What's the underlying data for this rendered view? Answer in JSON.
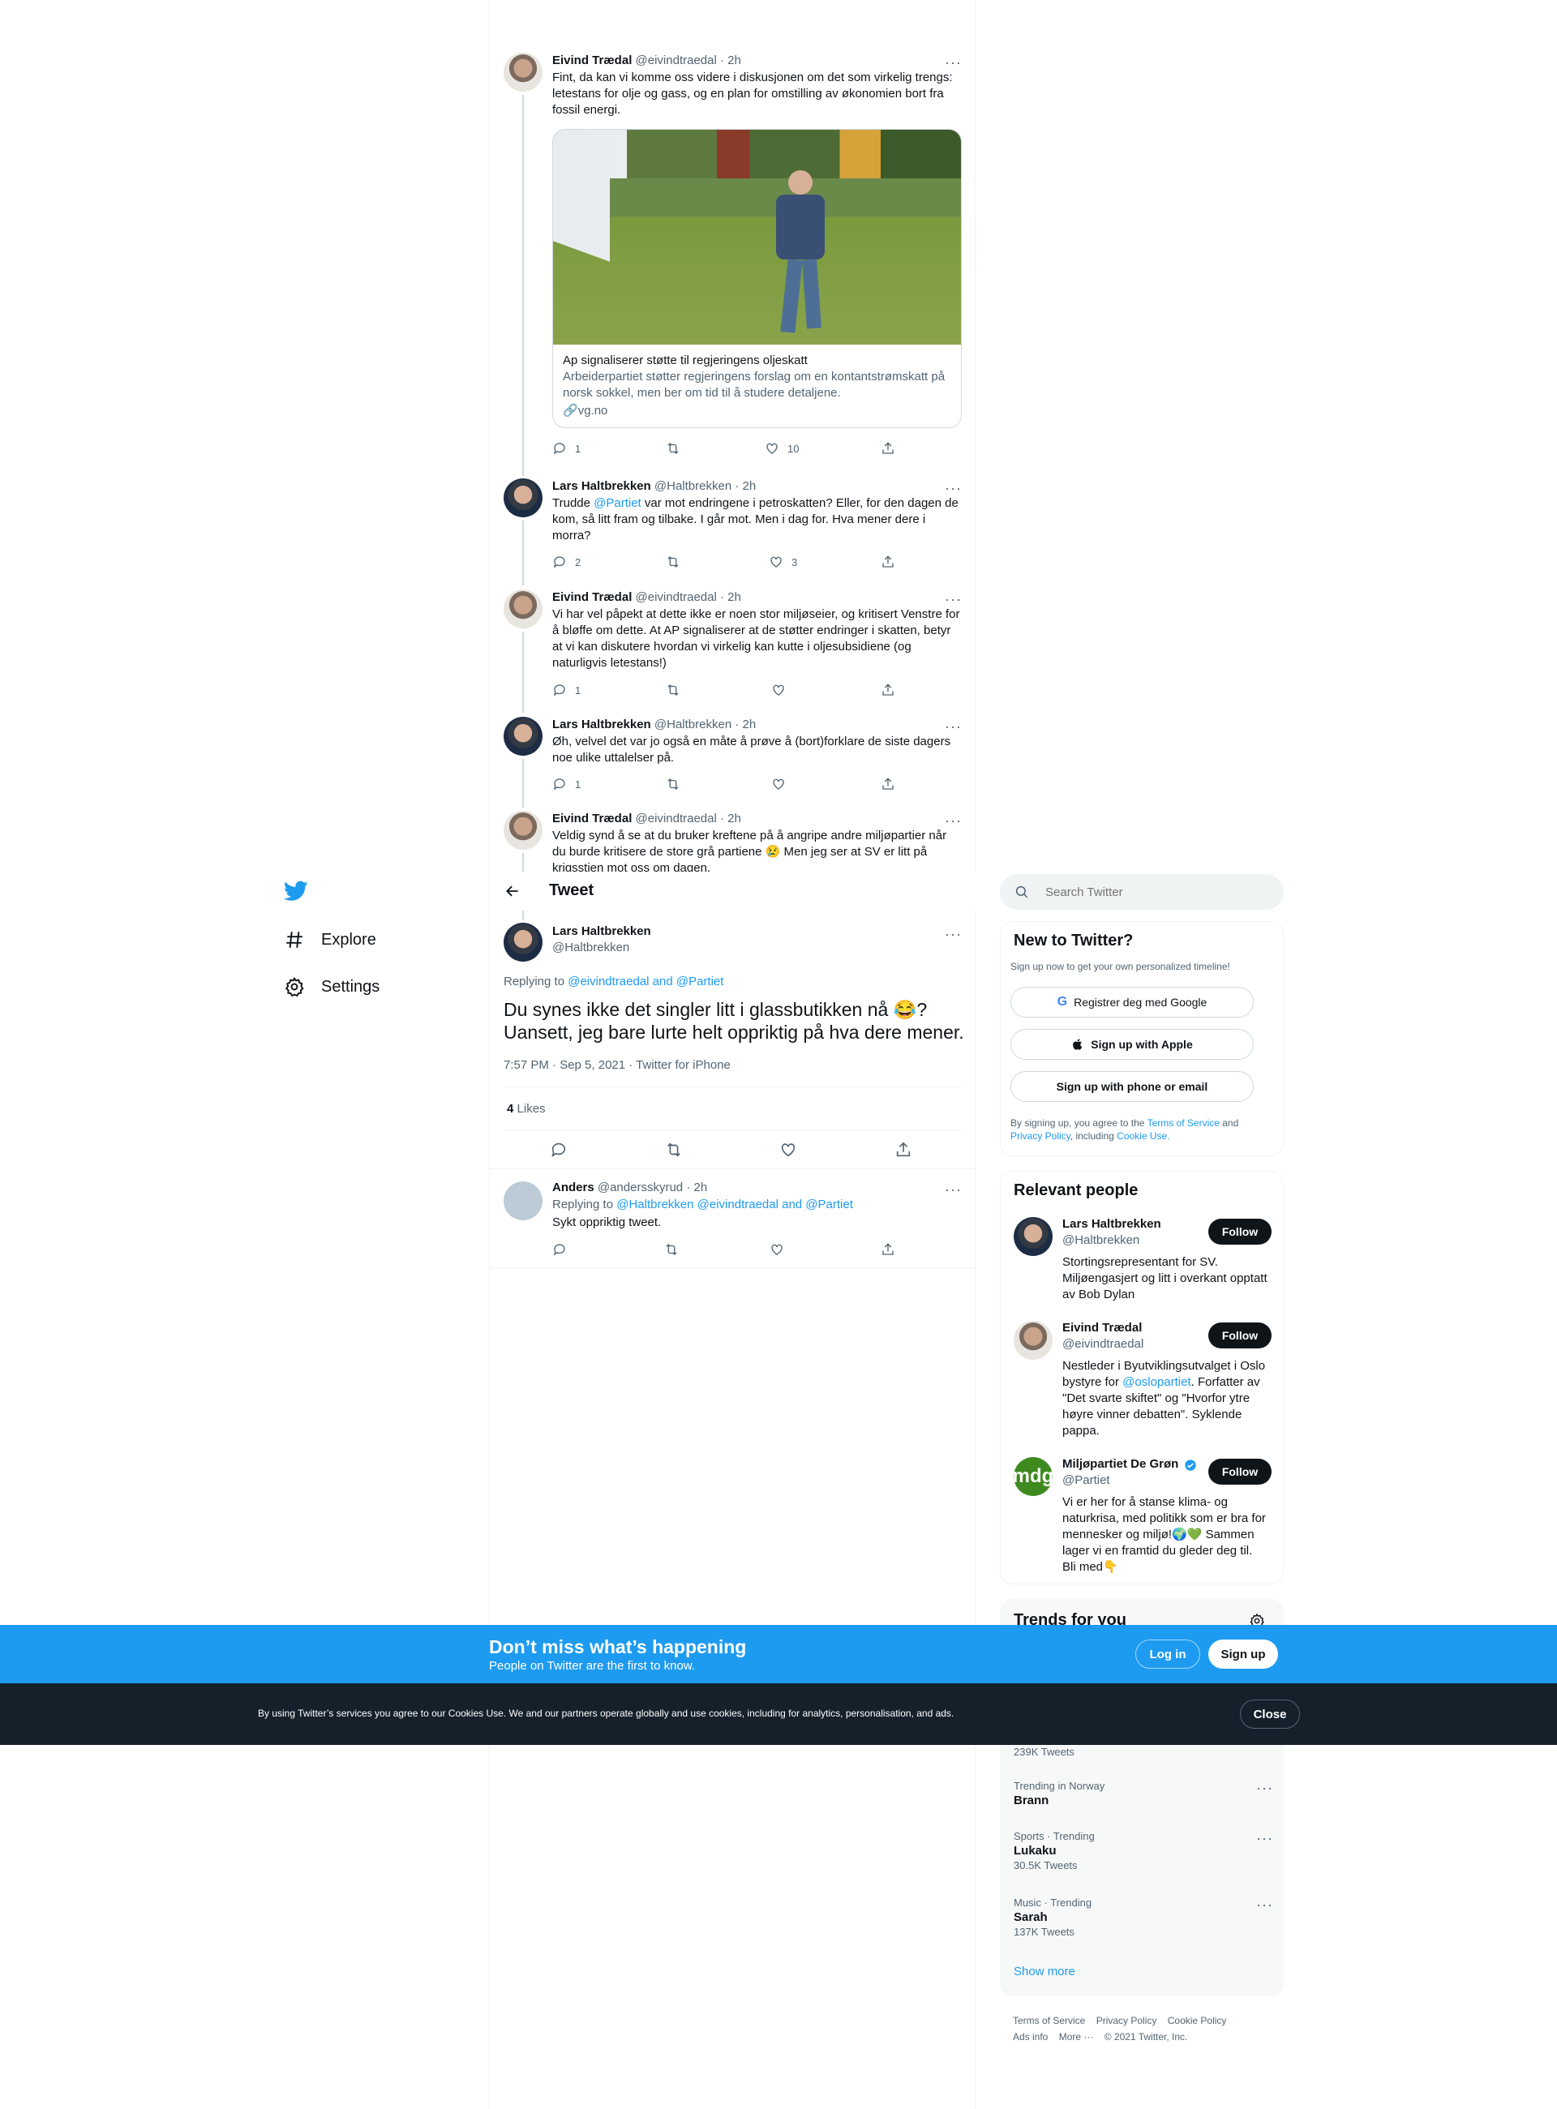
{
  "thread": [
    {
      "name": "Eivind Trædal",
      "handle": "@eivindtraedal",
      "time": "· 2h",
      "text": "Fint, da kan vi komme oss videre i diskusjonen om det som virkelig trengs: letestans for olje og gass, og en plan for omstilling av økonomien bort fra fossil energi.",
      "card": {
        "title": "Ap signaliserer støtte til regjeringens oljeskatt",
        "desc": "Arbeiderpartiet støtter regjeringens forslag om en kontantstrømskatt på norsk sokkel, men ber om tid til å studere detaljene.",
        "domain": "vg.no"
      },
      "replies": "1",
      "likes": "10"
    },
    {
      "name": "Lars Haltbrekken",
      "handle": "@Haltbrekken",
      "time": "· 2h",
      "pre": "Trudde ",
      "mention": "@Partiet",
      "text": " var mot endringene i petroskatten? Eller, for den dagen de kom, så litt fram og tilbake. I går mot. Men i dag for. Hva mener dere i morra?",
      "replies": "2",
      "likes": "3"
    },
    {
      "name": "Eivind Trædal",
      "handle": "@eivindtraedal",
      "time": "· 2h",
      "text": "Vi har vel påpekt at dette ikke er noen stor miljøseier, og kritisert Venstre for å bløffe om dette. At AP signaliserer at de støtter endringer i skatten, betyr at vi kan diskutere hvordan vi virkelig kan kutte i oljesubsidiene (og naturligvis letestans!)",
      "replies": "1",
      "likes": ""
    },
    {
      "name": "Lars Haltbrekken",
      "handle": "@Haltbrekken",
      "time": "· 2h",
      "text": "Øh, velvel det var jo også en måte å prøve å (bort)forklare de siste dagers noe ulike uttalelser på.",
      "replies": "1",
      "likes": ""
    },
    {
      "name": "Eivind Trædal",
      "handle": "@eivindtraedal",
      "time": "· 2h",
      "text": "Veldig synd å se at du bruker kreftene på å angripe andre miljøpartier når du burde kritisere de store grå partiene 😢  Men jeg ser at SV er litt på krigsstien mot oss om dagen.",
      "replies": "",
      "likes": ""
    }
  ],
  "header": {
    "title": "Tweet"
  },
  "nav": {
    "explore": "Explore",
    "settings": "Settings"
  },
  "main": {
    "name": "Lars Haltbrekken",
    "handle": "@Haltbrekken",
    "replying_label": "Replying to ",
    "replying_to": "@eivindtraedal and @Partiet",
    "text": "Du synes ikke det singler litt i glassbutikken nå 😂? Uansett, jeg bare lurte helt oppriktig på hva dere mener.",
    "meta": "7:57 PM · Sep 5, 2021 · Twitter for iPhone",
    "likes_count": "4",
    "likes_label": "Likes"
  },
  "reply": {
    "name": "Anders",
    "handle": "@andersskyrud",
    "time": "· 2h",
    "replying_label": "Replying to ",
    "replying_to": "@Haltbrekken @eivindtraedal and @Partiet",
    "text": "Sykt oppriktig tweet."
  },
  "search": {
    "placeholder": "Search Twitter"
  },
  "signup": {
    "title": "New to Twitter?",
    "subtitle": "Sign up now to get your own personalized timeline!",
    "google": "Registrer deg med Google",
    "apple": "Sign up with Apple",
    "phone": "Sign up with phone or email",
    "terms_pre": "By signing up, you agree to the ",
    "terms": "Terms of Service",
    "and": " and ",
    "privacy": "Privacy Policy",
    "including": ", including ",
    "cookie": "Cookie Use."
  },
  "relevant": {
    "title": "Relevant people",
    "follow": "Follow",
    "people": [
      {
        "name": "Lars Haltbrekken",
        "handle": "@Haltbrekken",
        "bio": "Stortingsrepresentant for SV. Miljøengasjert og litt i overkant opptatt av Bob Dylan"
      },
      {
        "name": "Eivind Trædal",
        "handle": "@eivindtraedal",
        "bio_pre": "Nestleder i Byutviklingsutvalget i Oslo bystyre for ",
        "bio_link": "@oslopartiet",
        "bio": ". Forfatter av \"Det svarte skiftet\" og \"Hvorfor ytre høyre vinner debatten\". Syklende pappa."
      },
      {
        "name": "Miljøpartiet De Grøn",
        "handle": "@Partiet",
        "avatar": "mdg",
        "bio": "Vi er her for å stanse klima- og naturkrisa, med politikk som er bra for mennesker og miljø!🌍💚 Sammen lager vi en framtid du gleder deg til. Bli med👇"
      }
    ]
  },
  "trends": {
    "title": "Trends for you",
    "items": [
      {
        "cat": "",
        "name": "",
        "count": "239K Tweets"
      },
      {
        "cat": "Trending in Norway",
        "name": "Brann",
        "count": ""
      },
      {
        "cat": "Sports · Trending",
        "name": "Lukaku",
        "count": "30.5K Tweets"
      },
      {
        "cat": "Music · Trending",
        "name": "Sarah",
        "count": "137K Tweets"
      }
    ],
    "show_more": "Show more"
  },
  "footer": {
    "terms": "Terms of Service",
    "privacy": "Privacy Policy",
    "cookie": "Cookie Policy",
    "ads": "Ads info",
    "more": "More ···",
    "copy": "© 2021 Twitter, Inc."
  },
  "banner": {
    "title": "Don’t miss what’s happening",
    "subtitle": "People on Twitter are the first to know.",
    "login": "Log in",
    "signup": "Sign up"
  },
  "cookies": {
    "text": "By using Twitter’s services you agree to our Cookies Use. We and our partners operate globally and use cookies, including for analytics, personalisation, and ads.",
    "close": "Close"
  },
  "colors": {
    "accent": "#1d9bf0",
    "text": "#0f1419",
    "secondary": "#536471",
    "cookie_bg": "#15202b"
  }
}
